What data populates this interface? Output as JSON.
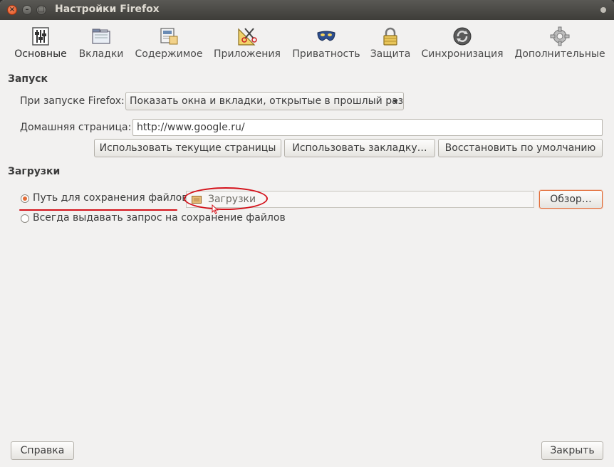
{
  "window": {
    "title": "Настройки Firefox"
  },
  "toolbar": [
    {
      "label": "Основные",
      "icon": "sliders-icon"
    },
    {
      "label": "Вкладки",
      "icon": "tabs-icon"
    },
    {
      "label": "Содержимое",
      "icon": "content-icon"
    },
    {
      "label": "Приложения",
      "icon": "applications-icon"
    },
    {
      "label": "Приватность",
      "icon": "mask-icon"
    },
    {
      "label": "Защита",
      "icon": "lock-icon"
    },
    {
      "label": "Синхронизация",
      "icon": "sync-icon"
    },
    {
      "label": "Дополнительные",
      "icon": "gear-icon"
    }
  ],
  "startup": {
    "heading": "Запуск",
    "when_label": "При запуске Firefox:",
    "when_value": "Показать окна и вкладки, открытые в прошлый раз",
    "home_label": "Домашняя страница:",
    "home_value": "http://www.google.ru/",
    "btn_current": "Использовать текущие страницы",
    "btn_bookmark": "Использовать закладку…",
    "btn_default": "Восстановить по умолчанию"
  },
  "downloads": {
    "heading": "Загрузки",
    "save_path_label": "Путь для сохранения файлов",
    "folder_value": "Загрузки",
    "browse_label": "Обзор…",
    "always_ask_label": "Всегда выдавать запрос на сохранение файлов"
  },
  "footer": {
    "help_label": "Справка",
    "close_label": "Закрыть"
  },
  "colors": {
    "accent": "#e26c36",
    "annotation": "#d4121b"
  }
}
